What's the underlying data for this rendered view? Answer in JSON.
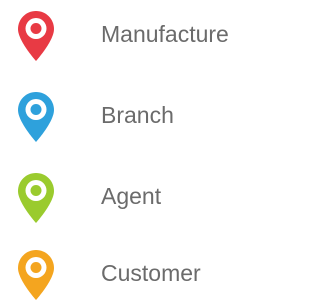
{
  "legend": {
    "items": [
      {
        "label": "Manufacture",
        "color": "#e83a44",
        "icon": "map-pin-icon"
      },
      {
        "label": "Branch",
        "color": "#2ea1dc",
        "icon": "map-pin-icon"
      },
      {
        "label": "Agent",
        "color": "#9acb2e",
        "icon": "map-pin-icon"
      },
      {
        "label": "Customer",
        "color": "#f4a51f",
        "icon": "map-pin-icon"
      }
    ]
  }
}
